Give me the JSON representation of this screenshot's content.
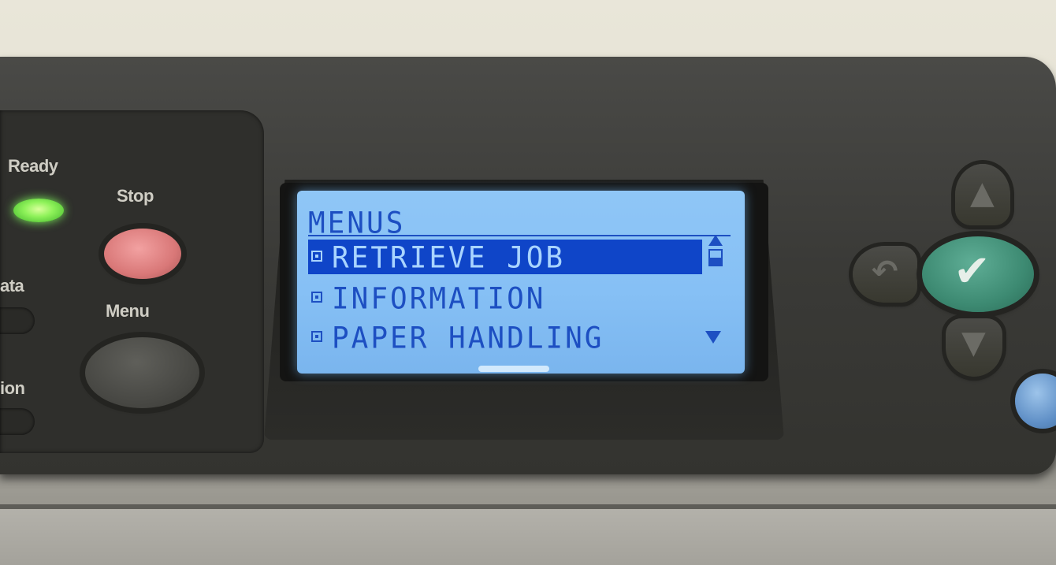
{
  "control_panel": {
    "labels": {
      "ready": "Ready",
      "stop": "Stop",
      "data": "ata",
      "menu": "Menu",
      "attention": "ion"
    },
    "ready_led_color": "#8ff25a",
    "stop_button_color": "#d97878",
    "check_button_color": "#3d8a72",
    "help_button_color": "#5f8fc6"
  },
  "display": {
    "title": "MENUS",
    "items": [
      {
        "label": "RETRIEVE JOB",
        "selected": true
      },
      {
        "label": "INFORMATION",
        "selected": false
      },
      {
        "label": "PAPER HANDLING",
        "selected": false
      }
    ],
    "background_color": "#86c0f5",
    "text_color": "#1d4fc2"
  },
  "nav": {
    "up_icon": "up-arrow-icon",
    "down_icon": "down-arrow-icon",
    "back_icon": "back-arrow-icon",
    "select_icon": "checkmark-icon"
  }
}
